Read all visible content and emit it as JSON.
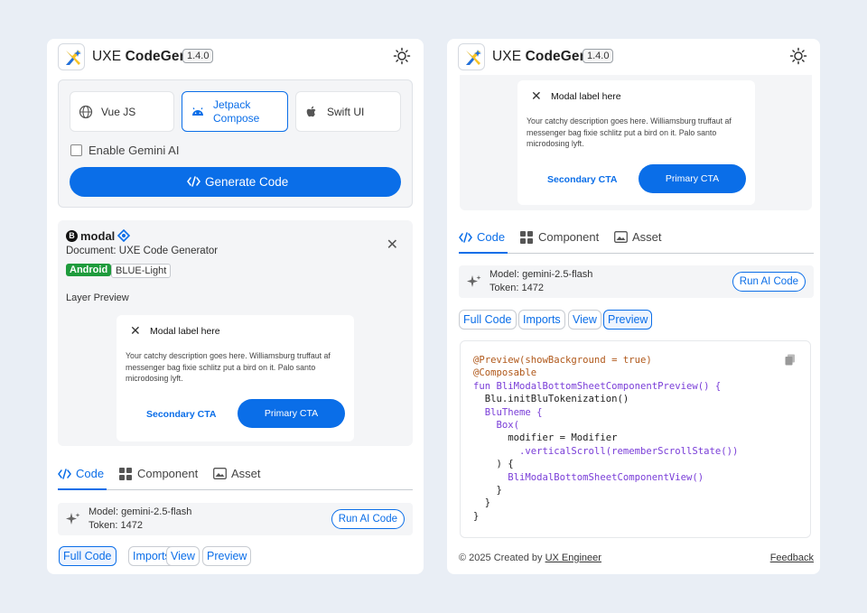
{
  "app": {
    "name_prefix": "UXE",
    "name_bold": "CodeGen",
    "version": "1.4.0"
  },
  "colors": {
    "accent": "#0a6ee8",
    "android_tag": "#1e9b3c",
    "panel_bg": "#f4f5f7"
  },
  "frameworks": [
    {
      "label": "Vue JS",
      "icon": "globe-icon",
      "selected": false
    },
    {
      "label": "Jetpack Compose",
      "line1": "Jetpack",
      "line2": "Compose",
      "icon": "android-icon",
      "selected": true
    },
    {
      "label": "Swift UI",
      "icon": "apple-icon",
      "selected": false
    }
  ],
  "gemini_checkbox": {
    "label": "Enable Gemini AI",
    "checked": false
  },
  "generate_button": {
    "label": "Generate Code",
    "icon": "code-icon"
  },
  "component": {
    "badge": "B",
    "name": "modal",
    "document": "Document: UXE Code Generator",
    "tags": [
      "Android",
      "BLUE-Light"
    ],
    "layer_preview_label": "Layer Preview"
  },
  "modal_preview": {
    "title": "Modal label here",
    "description": "Your catchy description goes here.  Williamsburg truffaut af messenger bag fixie schlitz put a bird on it. Palo santo microdosing lyft.",
    "secondary_cta": "Secondary CTA",
    "primary_cta": "Primary CTA"
  },
  "tabs": [
    {
      "label": "Code",
      "icon": "code-icon",
      "active": true
    },
    {
      "label": "Component",
      "icon": "grid-icon",
      "active": false
    },
    {
      "label": "Asset",
      "icon": "image-icon",
      "active": false
    }
  ],
  "model": {
    "line1": "Model: gemini-2.5-flash",
    "line2": "Token: 1472",
    "run_label": "Run AI Code"
  },
  "code_chips": [
    {
      "label": "Full Code",
      "selected_left": true,
      "selected_right": false
    },
    {
      "label": "Imports",
      "selected_left": false,
      "selected_right": false
    },
    {
      "label": "View",
      "selected_left": false,
      "selected_right": false
    },
    {
      "label": "Preview",
      "selected_left": false,
      "selected_right": true
    }
  ],
  "code_lines": [
    "@Preview(showBackground = true)",
    "@Composable",
    "fun BliModalBottomSheetComponentPreview() {",
    "  Blu.initBluTokenization()",
    "  BluTheme {",
    "    Box(",
    "      modifier = Modifier",
    "        .verticalScroll(rememberScrollState())",
    "    ) {",
    "      BliModalBottomSheetComponentView()",
    "    }",
    "  }",
    "}"
  ],
  "footer": {
    "copyright": "© 2025 Created by ",
    "author": "UX Engineer",
    "feedback": "Feedback"
  }
}
